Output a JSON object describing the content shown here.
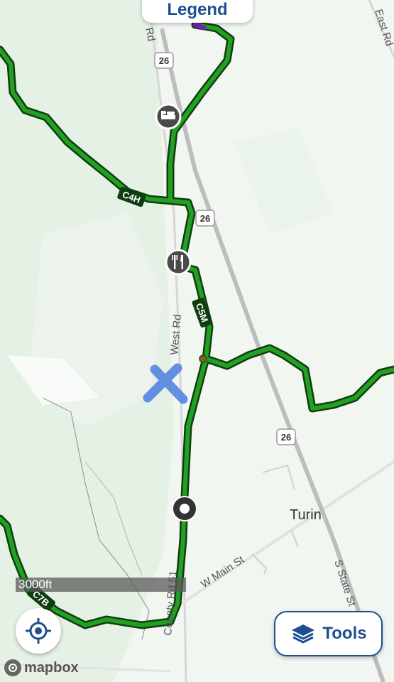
{
  "header": {
    "legend_label": "Legend"
  },
  "roads": {
    "route_26_a": "26",
    "route_26_b": "26",
    "route_26_c": "26",
    "top_left_road": "Rd",
    "top_right_road": "East Rd",
    "west_rd": "West Rd",
    "county_rd": "County Rd 51",
    "w_main_st": "W Main St",
    "s_state_st": "S State St"
  },
  "places": {
    "town": "Turin"
  },
  "trails": {
    "c4h": "C4H",
    "c5m": "C5M",
    "c7b": "C7B"
  },
  "scale_bar": {
    "label": "3000ft"
  },
  "controls": {
    "tools_label": "Tools"
  },
  "attribution": {
    "label": "mapbox"
  },
  "icons": [
    "lodging-icon",
    "restaurant-icon",
    "location-marker-icon",
    "locate-icon",
    "layers-icon",
    "mapbox-logo-icon"
  ],
  "colors": {
    "trail": "#1f9a1f",
    "trail_outline": "#0f3d0f",
    "accent": "#1f4f8f",
    "highway": "#bdbdbd",
    "marker_x": "#4c7fe0"
  }
}
